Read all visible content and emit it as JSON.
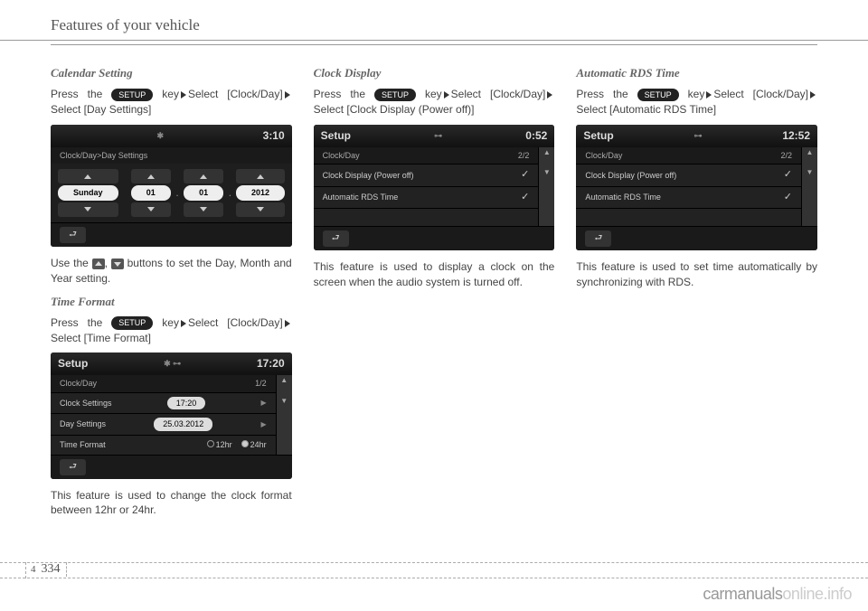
{
  "header": "Features of your vehicle",
  "page": {
    "section": "4",
    "num": "334"
  },
  "watermark": {
    "a": "carmanuals",
    "b": "online.info"
  },
  "setup_label": "SETUP",
  "col1": {
    "s1": {
      "title": "Calendar Setting",
      "line1a": "Press the ",
      "line1b": " key",
      "line1c": "Select [Clock/Day]",
      "line1d": "Select [Day Settings]",
      "after": "Use the ",
      "after2": ", ",
      "after3": " buttons to set the Day, Month and Year setting."
    },
    "scr1": {
      "bt": "✱",
      "time": "3:10",
      "breadcrumb": "Clock/Day>Day Settings",
      "day": "Sunday",
      "d": "01",
      "m": "01",
      "y": "2012"
    },
    "s2": {
      "title": "Time Format",
      "line1a": "Press the ",
      "line1b": " key",
      "line1c": "Select [Clock/Day]",
      "line1d": "Select [Time Format]",
      "after": "This feature is used to change the clock format between 12hr or 24hr."
    },
    "scr2": {
      "title": "Setup",
      "time": "17:20",
      "sub": "Clock/Day",
      "page": "1/2",
      "row1": "Clock Settings",
      "row1v": "17:20",
      "row2": "Day Settings",
      "row2v": "25.03.2012",
      "row3": "Time Format",
      "r12": "12hr",
      "r24": "24hr"
    }
  },
  "col2": {
    "s1": {
      "title": "Clock Display",
      "line1a": "Press the ",
      "line1b": " key",
      "line1c": "Select [Clock/Day]",
      "line1d": "Select [Clock Display (Power off)]",
      "after": "This feature is used to display a clock on the screen when the audio system is turned off."
    },
    "scr": {
      "title": "Setup",
      "time": "0:52",
      "sub": "Clock/Day",
      "page": "2/2",
      "row1": "Clock Display (Power off)",
      "row2": "Automatic RDS Time"
    }
  },
  "col3": {
    "s1": {
      "title": "Automatic RDS Time",
      "line1a": "Press the ",
      "line1b": " key",
      "line1c": "Select [Clock/Day]",
      "line1d": "Select [Automatic RDS Time]",
      "after": "This feature is used to set time automatically by synchronizing with RDS."
    },
    "scr": {
      "title": "Setup",
      "time": "12:52",
      "sub": "Clock/Day",
      "page": "2/2",
      "row1": "Clock Display (Power off)",
      "row2": "Automatic RDS Time"
    }
  }
}
